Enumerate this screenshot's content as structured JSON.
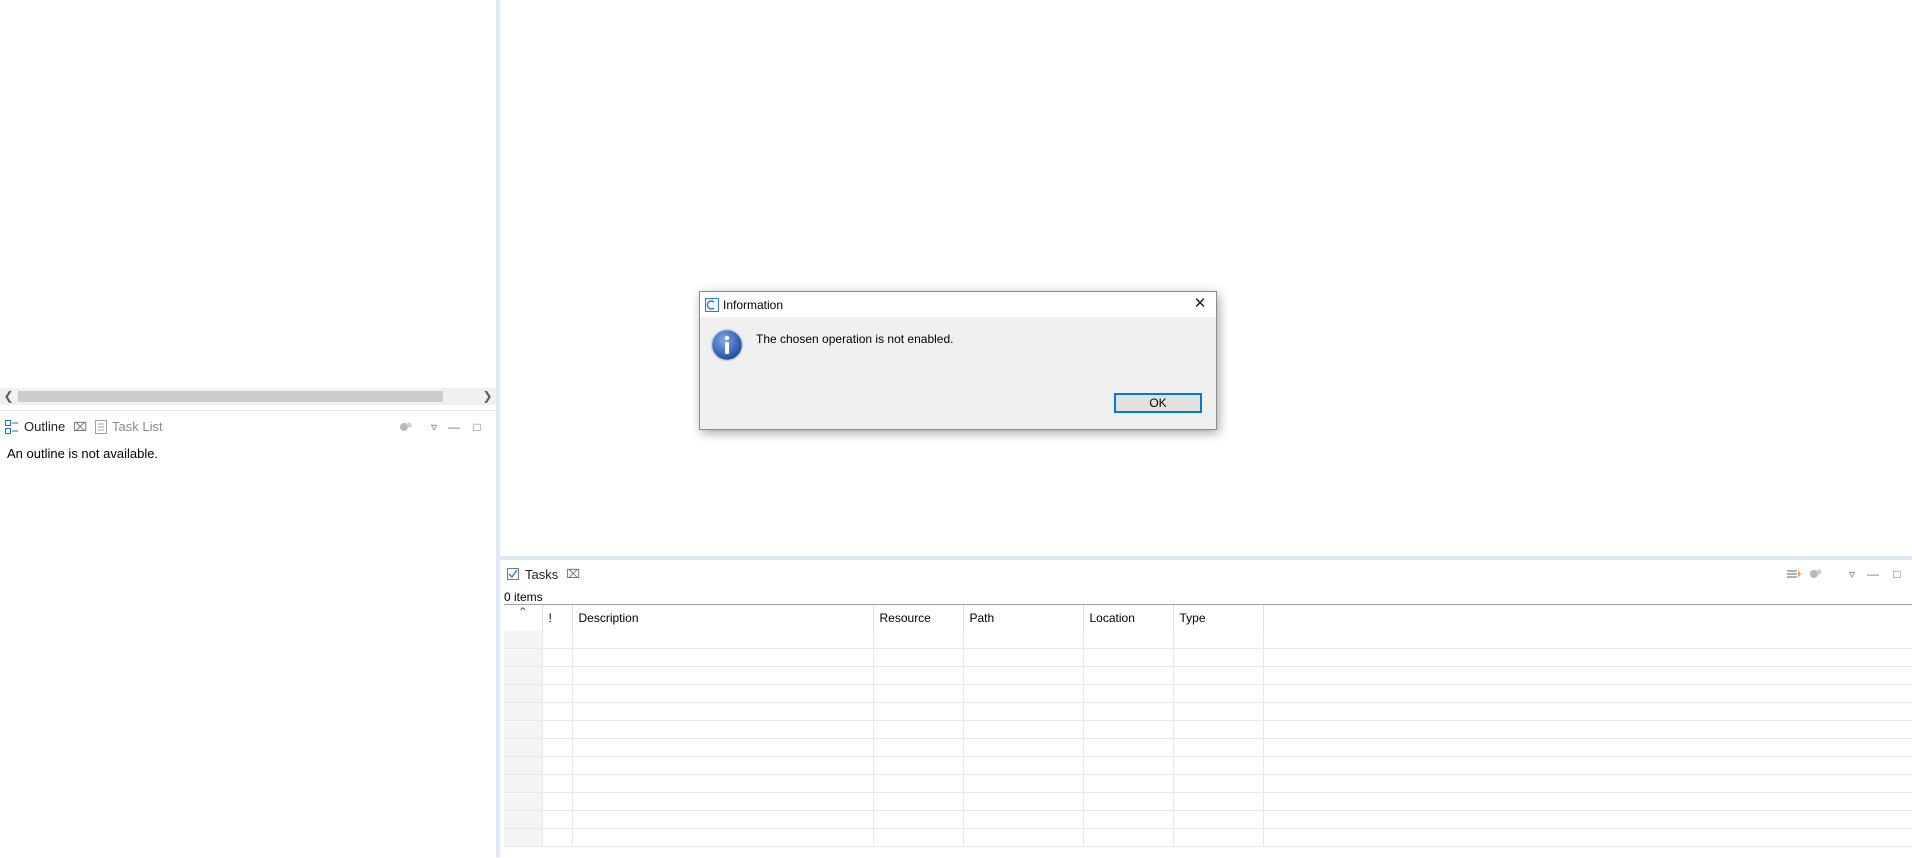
{
  "outline_panel": {
    "tabs": [
      {
        "label": "Outline",
        "active": true
      },
      {
        "label": "Task List",
        "active": false
      }
    ],
    "message": "An outline is not available."
  },
  "tasks_panel": {
    "tab_label": "Tasks",
    "items_count": "0 items",
    "columns": [
      "",
      "!",
      "Description",
      "Resource",
      "Path",
      "Location",
      "Type"
    ],
    "empty_rows": 12
  },
  "dialog": {
    "title": "Information",
    "message": "The chosen operation is not enabled.",
    "ok_label": "OK"
  },
  "colors": {
    "accent": "#0078d7",
    "divider": "#dfe8f3",
    "info_icon": "#2f5ea8"
  }
}
